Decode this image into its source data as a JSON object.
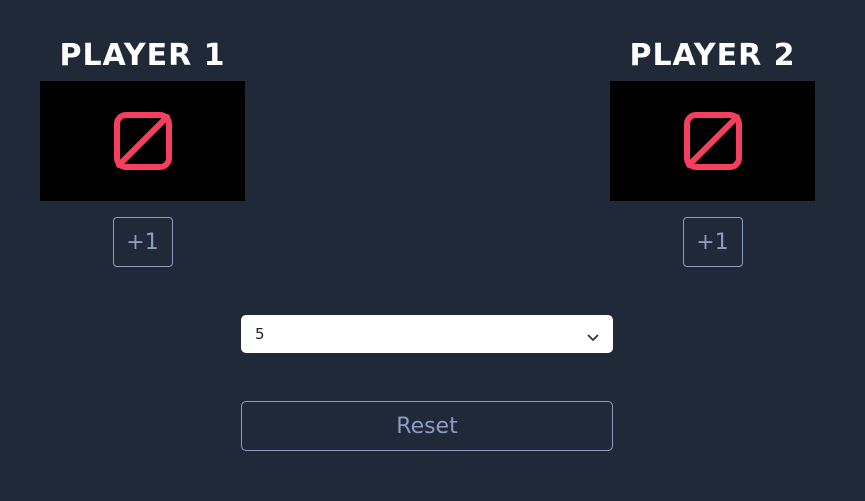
{
  "players": [
    {
      "title": "PLAYER 1",
      "score_icon": "no-symbol-icon",
      "increment_label": "+1"
    },
    {
      "title": "PLAYER 2",
      "score_icon": "no-symbol-icon",
      "increment_label": "+1"
    }
  ],
  "winning_score_select": {
    "value": "5",
    "icon": "chevron-down-icon"
  },
  "reset_label": "Reset",
  "colors": {
    "background": "#1f2937",
    "icon_red": "#f43f5e",
    "button_outline": "#8b9bc4",
    "score_box": "#000000"
  }
}
